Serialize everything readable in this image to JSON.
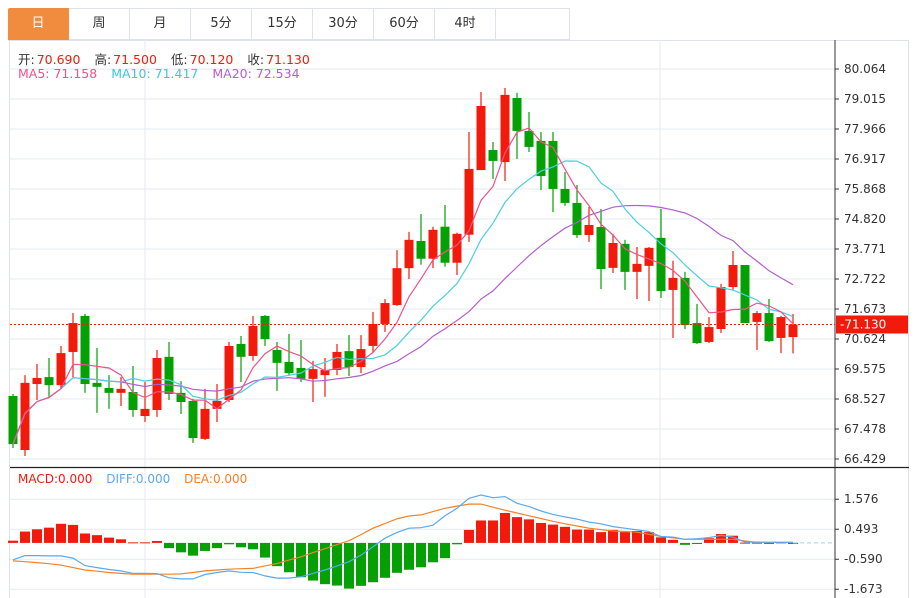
{
  "tabs": [
    {
      "label": "日",
      "active": true
    },
    {
      "label": "周"
    },
    {
      "label": "月"
    },
    {
      "label": "5分"
    },
    {
      "label": "15分"
    },
    {
      "label": "30分"
    },
    {
      "label": "60分"
    },
    {
      "label": "4时"
    }
  ],
  "ohlc_info": {
    "open_label": "开:",
    "open": "70.690",
    "high_label": "高:",
    "high": "71.500",
    "low_label": "低:",
    "low": "70.120",
    "close_label": "收:",
    "close": "71.130"
  },
  "ma_info": {
    "ma5": "MA5: 71.158",
    "ma10": "MA10: 71.417",
    "ma20": "MA20: 72.534"
  },
  "macd_info": {
    "macd": "MACD:0.000",
    "diff": "DIFF:0.000",
    "dea": "DEA:0.000"
  },
  "colors": {
    "up": "#f21a0a",
    "down": "#04a004",
    "ma5": "#f0528a",
    "ma10": "#4ccfe0",
    "ma20": "#b35fd0",
    "diff": "#5aaaf0",
    "dea": "#f5822a",
    "active_tab": "#f18b3e"
  },
  "chart_data": [
    {
      "type": "candlestick",
      "title": "",
      "price_axis_ticks": [
        "80.064",
        "79.015",
        "77.966",
        "76.917",
        "75.868",
        "74.820",
        "73.771",
        "72.722",
        "71.673",
        "70.624",
        "69.575",
        "68.527",
        "67.478",
        "66.429"
      ],
      "ylim": [
        66.429,
        80.064
      ],
      "last_price": "71.130",
      "moving_averages": [
        "MA5",
        "MA10",
        "MA20"
      ],
      "candles": [
        [
          68.63,
          68.7,
          66.81,
          66.95
        ],
        [
          66.74,
          69.36,
          66.53,
          69.09
        ],
        [
          69.05,
          69.75,
          68.49,
          69.26
        ],
        [
          69.29,
          69.96,
          68.6,
          69.01
        ],
        [
          69.01,
          70.38,
          68.91,
          70.13
        ],
        [
          70.17,
          71.53,
          69.29,
          71.18
        ],
        [
          71.43,
          71.5,
          68.74,
          69.05
        ],
        [
          69.09,
          70.31,
          68.04,
          68.95
        ],
        [
          68.91,
          69.36,
          68.18,
          68.74
        ],
        [
          68.74,
          69.29,
          68.28,
          68.88
        ],
        [
          68.77,
          69.68,
          67.9,
          68.14
        ],
        [
          67.93,
          69.12,
          67.72,
          68.18
        ],
        [
          68.14,
          70.24,
          67.9,
          69.96
        ],
        [
          70.0,
          70.52,
          68.49,
          68.7
        ],
        [
          68.74,
          69.15,
          68.0,
          68.42
        ],
        [
          68.46,
          68.53,
          66.99,
          67.16
        ],
        [
          67.13,
          68.88,
          67.09,
          68.18
        ],
        [
          68.18,
          69.05,
          67.72,
          68.46
        ],
        [
          68.49,
          70.52,
          68.42,
          70.38
        ],
        [
          70.45,
          70.73,
          69.12,
          70.0
        ],
        [
          70.03,
          71.43,
          69.86,
          71.08
        ],
        [
          71.43,
          71.46,
          70.38,
          70.62
        ],
        [
          70.24,
          70.52,
          68.81,
          69.79
        ],
        [
          69.82,
          70.8,
          69.36,
          69.43
        ],
        [
          69.61,
          70.59,
          69.12,
          69.23
        ],
        [
          69.23,
          69.86,
          68.42,
          69.57
        ],
        [
          69.36,
          69.96,
          68.6,
          69.54
        ],
        [
          69.54,
          70.45,
          69.36,
          70.17
        ],
        [
          70.2,
          70.76,
          69.33,
          69.64
        ],
        [
          69.64,
          70.76,
          69.43,
          70.27
        ],
        [
          70.38,
          71.57,
          70.17,
          71.15
        ],
        [
          71.15,
          72.02,
          70.87,
          71.88
        ],
        [
          71.81,
          73.73,
          71.78,
          73.1
        ],
        [
          73.1,
          74.37,
          72.72,
          74.09
        ],
        [
          74.05,
          74.99,
          73.22,
          73.43
        ],
        [
          73.43,
          74.55,
          73.1,
          74.44
        ],
        [
          74.55,
          75.31,
          73.15,
          73.29
        ],
        [
          73.29,
          74.34,
          72.86,
          74.3
        ],
        [
          74.27,
          77.86,
          74.02,
          76.57
        ],
        [
          76.53,
          79.26,
          76.53,
          78.77
        ],
        [
          77.23,
          77.51,
          76.22,
          76.85
        ],
        [
          76.81,
          79.4,
          76.15,
          79.16
        ],
        [
          79.05,
          79.23,
          76.92,
          77.9
        ],
        [
          77.9,
          78.56,
          77.16,
          77.34
        ],
        [
          77.55,
          77.86,
          75.83,
          76.32
        ],
        [
          77.55,
          77.86,
          75.06,
          75.87
        ],
        [
          75.87,
          76.46,
          75.28,
          75.38
        ],
        [
          75.38,
          76.01,
          74.16,
          74.26
        ],
        [
          74.26,
          75.24,
          74.02,
          74.61
        ],
        [
          74.54,
          75.17,
          72.37,
          73.07
        ],
        [
          73.11,
          74.3,
          72.93,
          73.98
        ],
        [
          73.95,
          74.09,
          72.34,
          72.97
        ],
        [
          72.97,
          73.84,
          72.02,
          73.25
        ],
        [
          73.18,
          73.84,
          71.95,
          73.81
        ],
        [
          74.16,
          75.17,
          72.06,
          72.3
        ],
        [
          72.34,
          73.36,
          70.66,
          72.76
        ],
        [
          72.76,
          72.97,
          70.97,
          71.11
        ],
        [
          71.18,
          71.85,
          70.45,
          70.48
        ],
        [
          70.52,
          71.39,
          70.48,
          71.04
        ],
        [
          70.97,
          72.55,
          70.83,
          72.44
        ],
        [
          72.44,
          73.7,
          72.34,
          73.21
        ],
        [
          73.21,
          73.21,
          71.18,
          71.18
        ],
        [
          71.22,
          71.6,
          70.24,
          71.53
        ],
        [
          71.53,
          72.02,
          70.52,
          70.55
        ],
        [
          70.66,
          71.43,
          70.13,
          71.39
        ],
        [
          70.69,
          71.5,
          70.12,
          71.13
        ]
      ]
    },
    {
      "type": "bar+line",
      "title": "MACD",
      "axis_ticks": [
        "1.576",
        "0.493",
        "-0.590",
        "-1.673"
      ],
      "ylim": [
        -1.673,
        1.576
      ],
      "macd_hist": [
        0.08,
        0.41,
        0.49,
        0.55,
        0.69,
        0.65,
        0.34,
        0.28,
        0.19,
        0.13,
        0.02,
        0.02,
        0.07,
        -0.19,
        -0.34,
        -0.46,
        -0.29,
        -0.19,
        -0.05,
        -0.16,
        -0.23,
        -0.53,
        -0.84,
        -1.06,
        -1.24,
        -1.36,
        -1.49,
        -1.54,
        -1.65,
        -1.55,
        -1.42,
        -1.26,
        -1.08,
        -0.97,
        -0.88,
        -0.7,
        -0.55,
        -0.05,
        0.47,
        0.81,
        0.81,
        1.08,
        0.93,
        0.85,
        0.72,
        0.66,
        0.58,
        0.48,
        0.48,
        0.39,
        0.47,
        0.39,
        0.43,
        0.39,
        0.2,
        0.11,
        -0.07,
        -0.04,
        0.17,
        0.32,
        0.26,
        0.01,
        0.01,
        -0.03,
        0.02,
        0.0
      ],
      "diff": [
        -0.61,
        -0.46,
        -0.46,
        -0.47,
        -0.47,
        -0.55,
        -0.82,
        -0.89,
        -0.96,
        -1.01,
        -1.1,
        -1.1,
        -1.11,
        -1.26,
        -1.3,
        -1.3,
        -1.14,
        -1.07,
        -1.01,
        -1.06,
        -1.07,
        -1.19,
        -1.27,
        -1.27,
        -1.22,
        -1.1,
        -0.98,
        -0.83,
        -0.68,
        -0.44,
        -0.14,
        0.17,
        0.38,
        0.53,
        0.55,
        0.64,
        0.98,
        1.25,
        1.61,
        1.73,
        1.63,
        1.67,
        1.43,
        1.31,
        1.15,
        1.03,
        0.94,
        0.86,
        0.75,
        0.69,
        0.59,
        0.53,
        0.47,
        0.41,
        0.23,
        0.21,
        0.13,
        0.15,
        0.19,
        0.27,
        0.21,
        0.03,
        0.03,
        0.02,
        0.02,
        0.02
      ],
      "dea": [
        -0.65,
        -0.68,
        -0.71,
        -0.75,
        -0.8,
        -0.89,
        -0.98,
        -1.02,
        -1.07,
        -1.1,
        -1.13,
        -1.13,
        -1.13,
        -1.13,
        -1.12,
        -1.07,
        -1.01,
        -0.98,
        -0.95,
        -0.93,
        -0.92,
        -0.83,
        -0.74,
        -0.62,
        -0.5,
        -0.35,
        -0.21,
        -0.06,
        0.08,
        0.3,
        0.53,
        0.7,
        0.87,
        0.97,
        1.01,
        1.13,
        1.25,
        1.33,
        1.4,
        1.4,
        1.29,
        1.18,
        1.08,
        0.98,
        0.88,
        0.78,
        0.69,
        0.61,
        0.53,
        0.48,
        0.43,
        0.41,
        0.39,
        0.31,
        0.23,
        0.18,
        0.13,
        0.13,
        0.13,
        0.13,
        0.13,
        0.07,
        0.02,
        0.02,
        0.02,
        0.02
      ]
    }
  ]
}
